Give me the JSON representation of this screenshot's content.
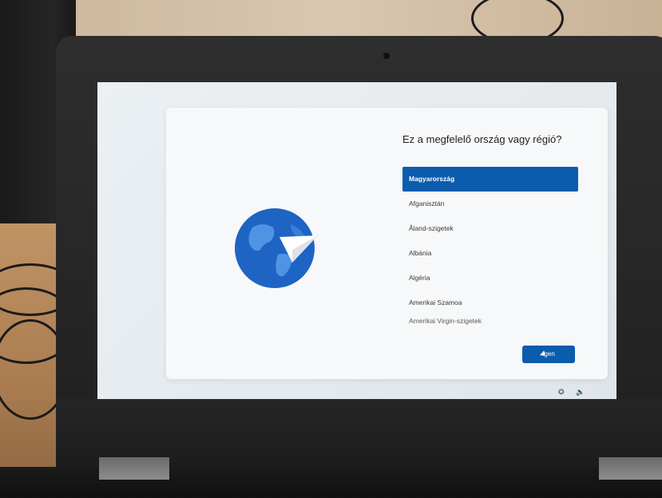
{
  "setup": {
    "question": "Ez a megfelelő ország vagy régió?",
    "countries": [
      {
        "label": "Magyarország",
        "selected": true
      },
      {
        "label": "Afganisztán",
        "selected": false
      },
      {
        "label": "Åland-szigetek",
        "selected": false
      },
      {
        "label": "Albánia",
        "selected": false
      },
      {
        "label": "Algéria",
        "selected": false
      },
      {
        "label": "Amerikai Szamoa",
        "selected": false
      },
      {
        "label": "Amerikai Virgin-szigetek",
        "selected": false
      }
    ],
    "next_label": "Igen"
  },
  "tray": {
    "accessibility_icon": "accessibility-icon",
    "volume_icon": "volume-icon"
  },
  "colors": {
    "accent": "#0b5cad",
    "screen_bg": "#e4eaee",
    "dialog_bg": "#f7f8f9"
  }
}
